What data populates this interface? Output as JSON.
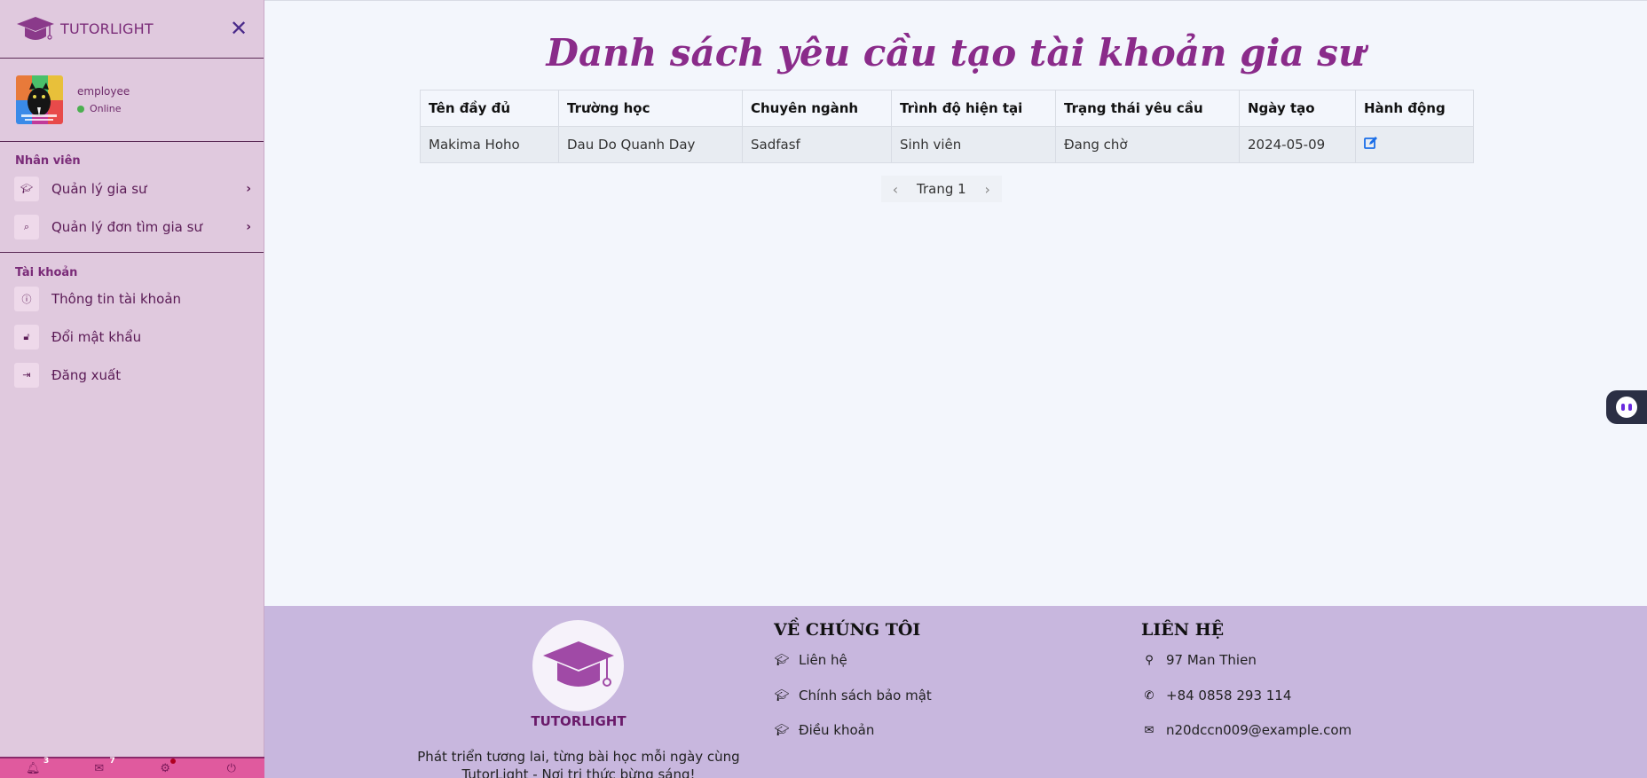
{
  "sidebar": {
    "brand": "TUTORLIGHT",
    "user": {
      "name": "employee",
      "status": "Online"
    },
    "sections": [
      {
        "title": "Nhân viên"
      },
      {
        "title": "Tài khoản"
      }
    ],
    "employee_items": [
      {
        "label": "Quản lý gia sư",
        "icon": "graduation-cap-icon"
      },
      {
        "label": "Quản lý đơn tìm gia sư",
        "icon": "search-icon"
      }
    ],
    "account_items": [
      {
        "label": "Thông tin tài khoản",
        "icon": "info-icon"
      },
      {
        "label": "Đổi mật khẩu",
        "icon": "lock-icon"
      },
      {
        "label": "Đăng xuất",
        "icon": "sign-out-icon"
      }
    ],
    "bottom_bar": {
      "notifications_count": "3",
      "messages_count": "7"
    }
  },
  "main": {
    "title": "Danh sách yêu cầu tạo tài khoản gia sư",
    "table": {
      "headers": [
        "Tên đầy đủ",
        "Trường học",
        "Chuyên ngành",
        "Trình độ hiện tại",
        "Trạng thái yêu cầu",
        "Ngày tạo",
        "Hành động"
      ],
      "rows": [
        [
          "Makima Hoho",
          "Dau Do Quanh Day",
          "Sadfasf",
          "Sinh viên",
          "Đang chờ",
          "2024-05-09"
        ]
      ]
    },
    "pager": {
      "label": "Trang 1"
    }
  },
  "footer": {
    "brand": "TUTORLIGHT",
    "slogan_line1": "Phát triển tương lai, từng bài học mỗi ngày cùng",
    "slogan_line2": "TutorLight - Nơi tri thức bừng sáng!",
    "about": {
      "title": "VỀ CHÚNG TÔI",
      "links": [
        "Liên hệ",
        "Chính sách bảo mật",
        "Điều khoản"
      ]
    },
    "contact": {
      "title": "LIÊN HỆ",
      "address": "97 Man Thien",
      "phone": "+84 0858 293 114",
      "email": "n20dccn009@example.com"
    }
  },
  "colors": {
    "sidebar_bg": "#e0c9de",
    "title_purple": "#8a2b8a",
    "footer_bg": "#c8b7de",
    "bottom_bar": "#e05a9e",
    "edit_blue": "#1a6ee8"
  }
}
